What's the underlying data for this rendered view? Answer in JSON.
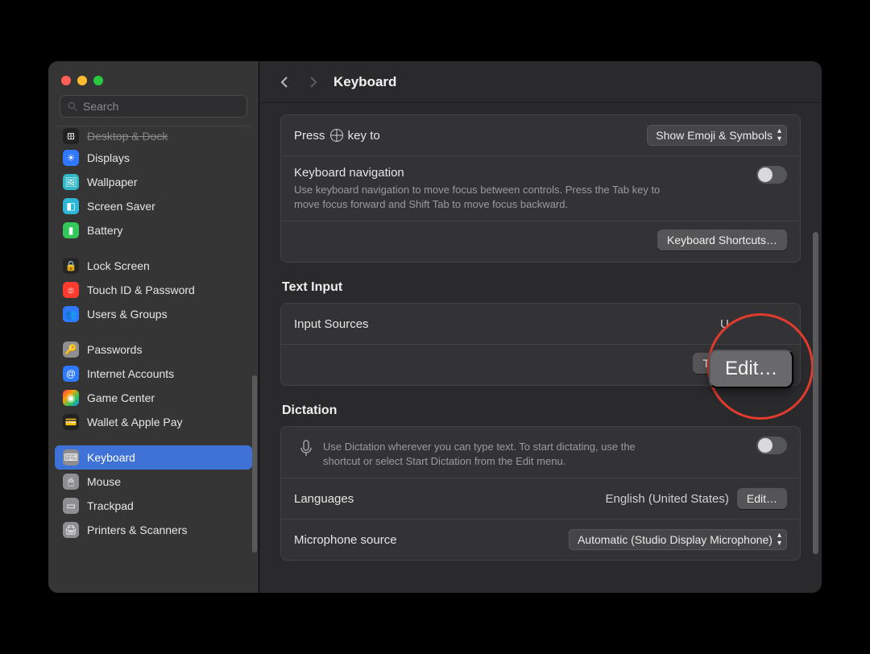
{
  "search": {
    "placeholder": "Search"
  },
  "title": "Keyboard",
  "sidebar": {
    "items": [
      {
        "label": "Desktop & Dock"
      },
      {
        "label": "Displays"
      },
      {
        "label": "Wallpaper"
      },
      {
        "label": "Screen Saver"
      },
      {
        "label": "Battery"
      },
      {
        "label": "Lock Screen"
      },
      {
        "label": "Touch ID & Password"
      },
      {
        "label": "Users & Groups"
      },
      {
        "label": "Passwords"
      },
      {
        "label": "Internet Accounts"
      },
      {
        "label": "Game Center"
      },
      {
        "label": "Wallet & Apple Pay"
      },
      {
        "label": "Keyboard"
      },
      {
        "label": "Mouse"
      },
      {
        "label": "Trackpad"
      },
      {
        "label": "Printers & Scanners"
      }
    ]
  },
  "press_key": {
    "label_prefix": "Press ",
    "label_suffix": " key to",
    "value": "Show Emoji & Symbols"
  },
  "kbnav": {
    "title": "Keyboard navigation",
    "desc": "Use keyboard navigation to move focus between controls. Press the Tab key to move focus forward and Shift Tab to move focus backward."
  },
  "shortcuts_button": "Keyboard Shortcuts…",
  "text_input": {
    "heading": "Text Input",
    "input_sources_label": "Input Sources",
    "input_sources_value_partial": "U",
    "edit_button": "Edit…",
    "text_replacements_partial": "Text Replacem"
  },
  "dictation": {
    "heading": "Dictation",
    "desc": "Use Dictation wherever you can type text. To start dictating, use the shortcut or select Start Dictation from the Edit menu.",
    "languages_label": "Languages",
    "languages_value": "English (United States)",
    "languages_edit": "Edit…",
    "mic_label": "Microphone source",
    "mic_value": "Automatic (Studio Display Microphone)"
  }
}
